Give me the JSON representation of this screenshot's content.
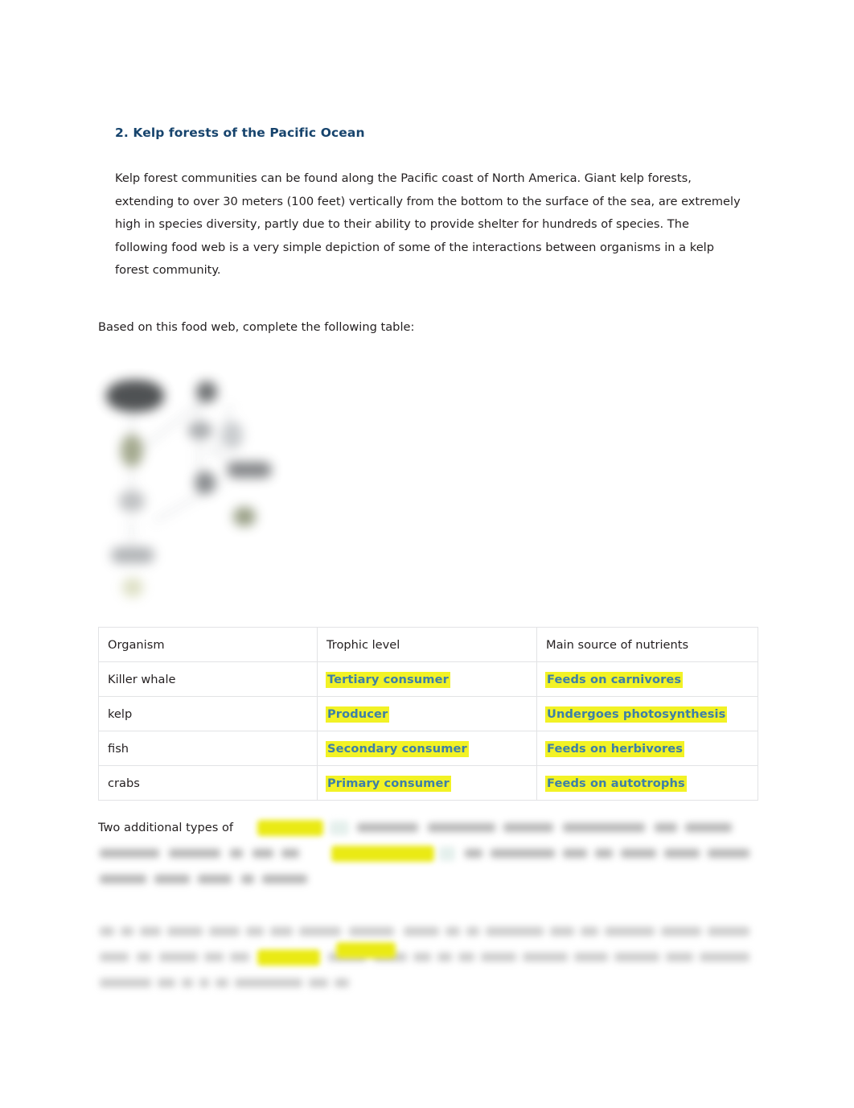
{
  "document": {
    "section_heading": "2. Kelp forests of the Pacific Ocean",
    "intro_paragraph": "Kelp forest communities can be found along the Pacific coast of North America. Giant kelp forests, extending to over 30 meters (100 feet) vertically from the bottom to the surface of the sea, are extremely high in species diversity, partly due to their ability to provide shelter for hundreds of species. The following food web is a very simple depiction of some of the interactions between organisms in a kelp forest community.",
    "prompt_line": "Based on this food web, complete the following table:",
    "trailing_paragraph_visible_lead": "Two additional types of"
  },
  "figure": {
    "name": "kelp-forest-food-web-diagram",
    "state": "blurred"
  },
  "table": {
    "columns": [
      "Organism",
      "Trophic level",
      "Main source of nutrients"
    ],
    "rows": [
      {
        "organism": "Killer whale",
        "trophic_level": "Tertiary consumer",
        "nutrient_source": "Feeds on carnivores"
      },
      {
        "organism": "kelp",
        "trophic_level": "Producer",
        "nutrient_source": "Undergoes photosynthesis"
      },
      {
        "organism": "fish",
        "trophic_level": "Secondary consumer",
        "nutrient_source": "Feeds on herbivores"
      },
      {
        "organism": "crabs",
        "trophic_level": "Primary consumer",
        "nutrient_source": "Feeds on autotrophs"
      }
    ]
  },
  "colors": {
    "heading_navy": "#17446d",
    "answer_text_blue": "#3d7fa8",
    "highlight_yellow": "#f2f225",
    "body_text": "#231f20",
    "table_border": "#e2e3e5",
    "page_background": "#ffffff"
  }
}
